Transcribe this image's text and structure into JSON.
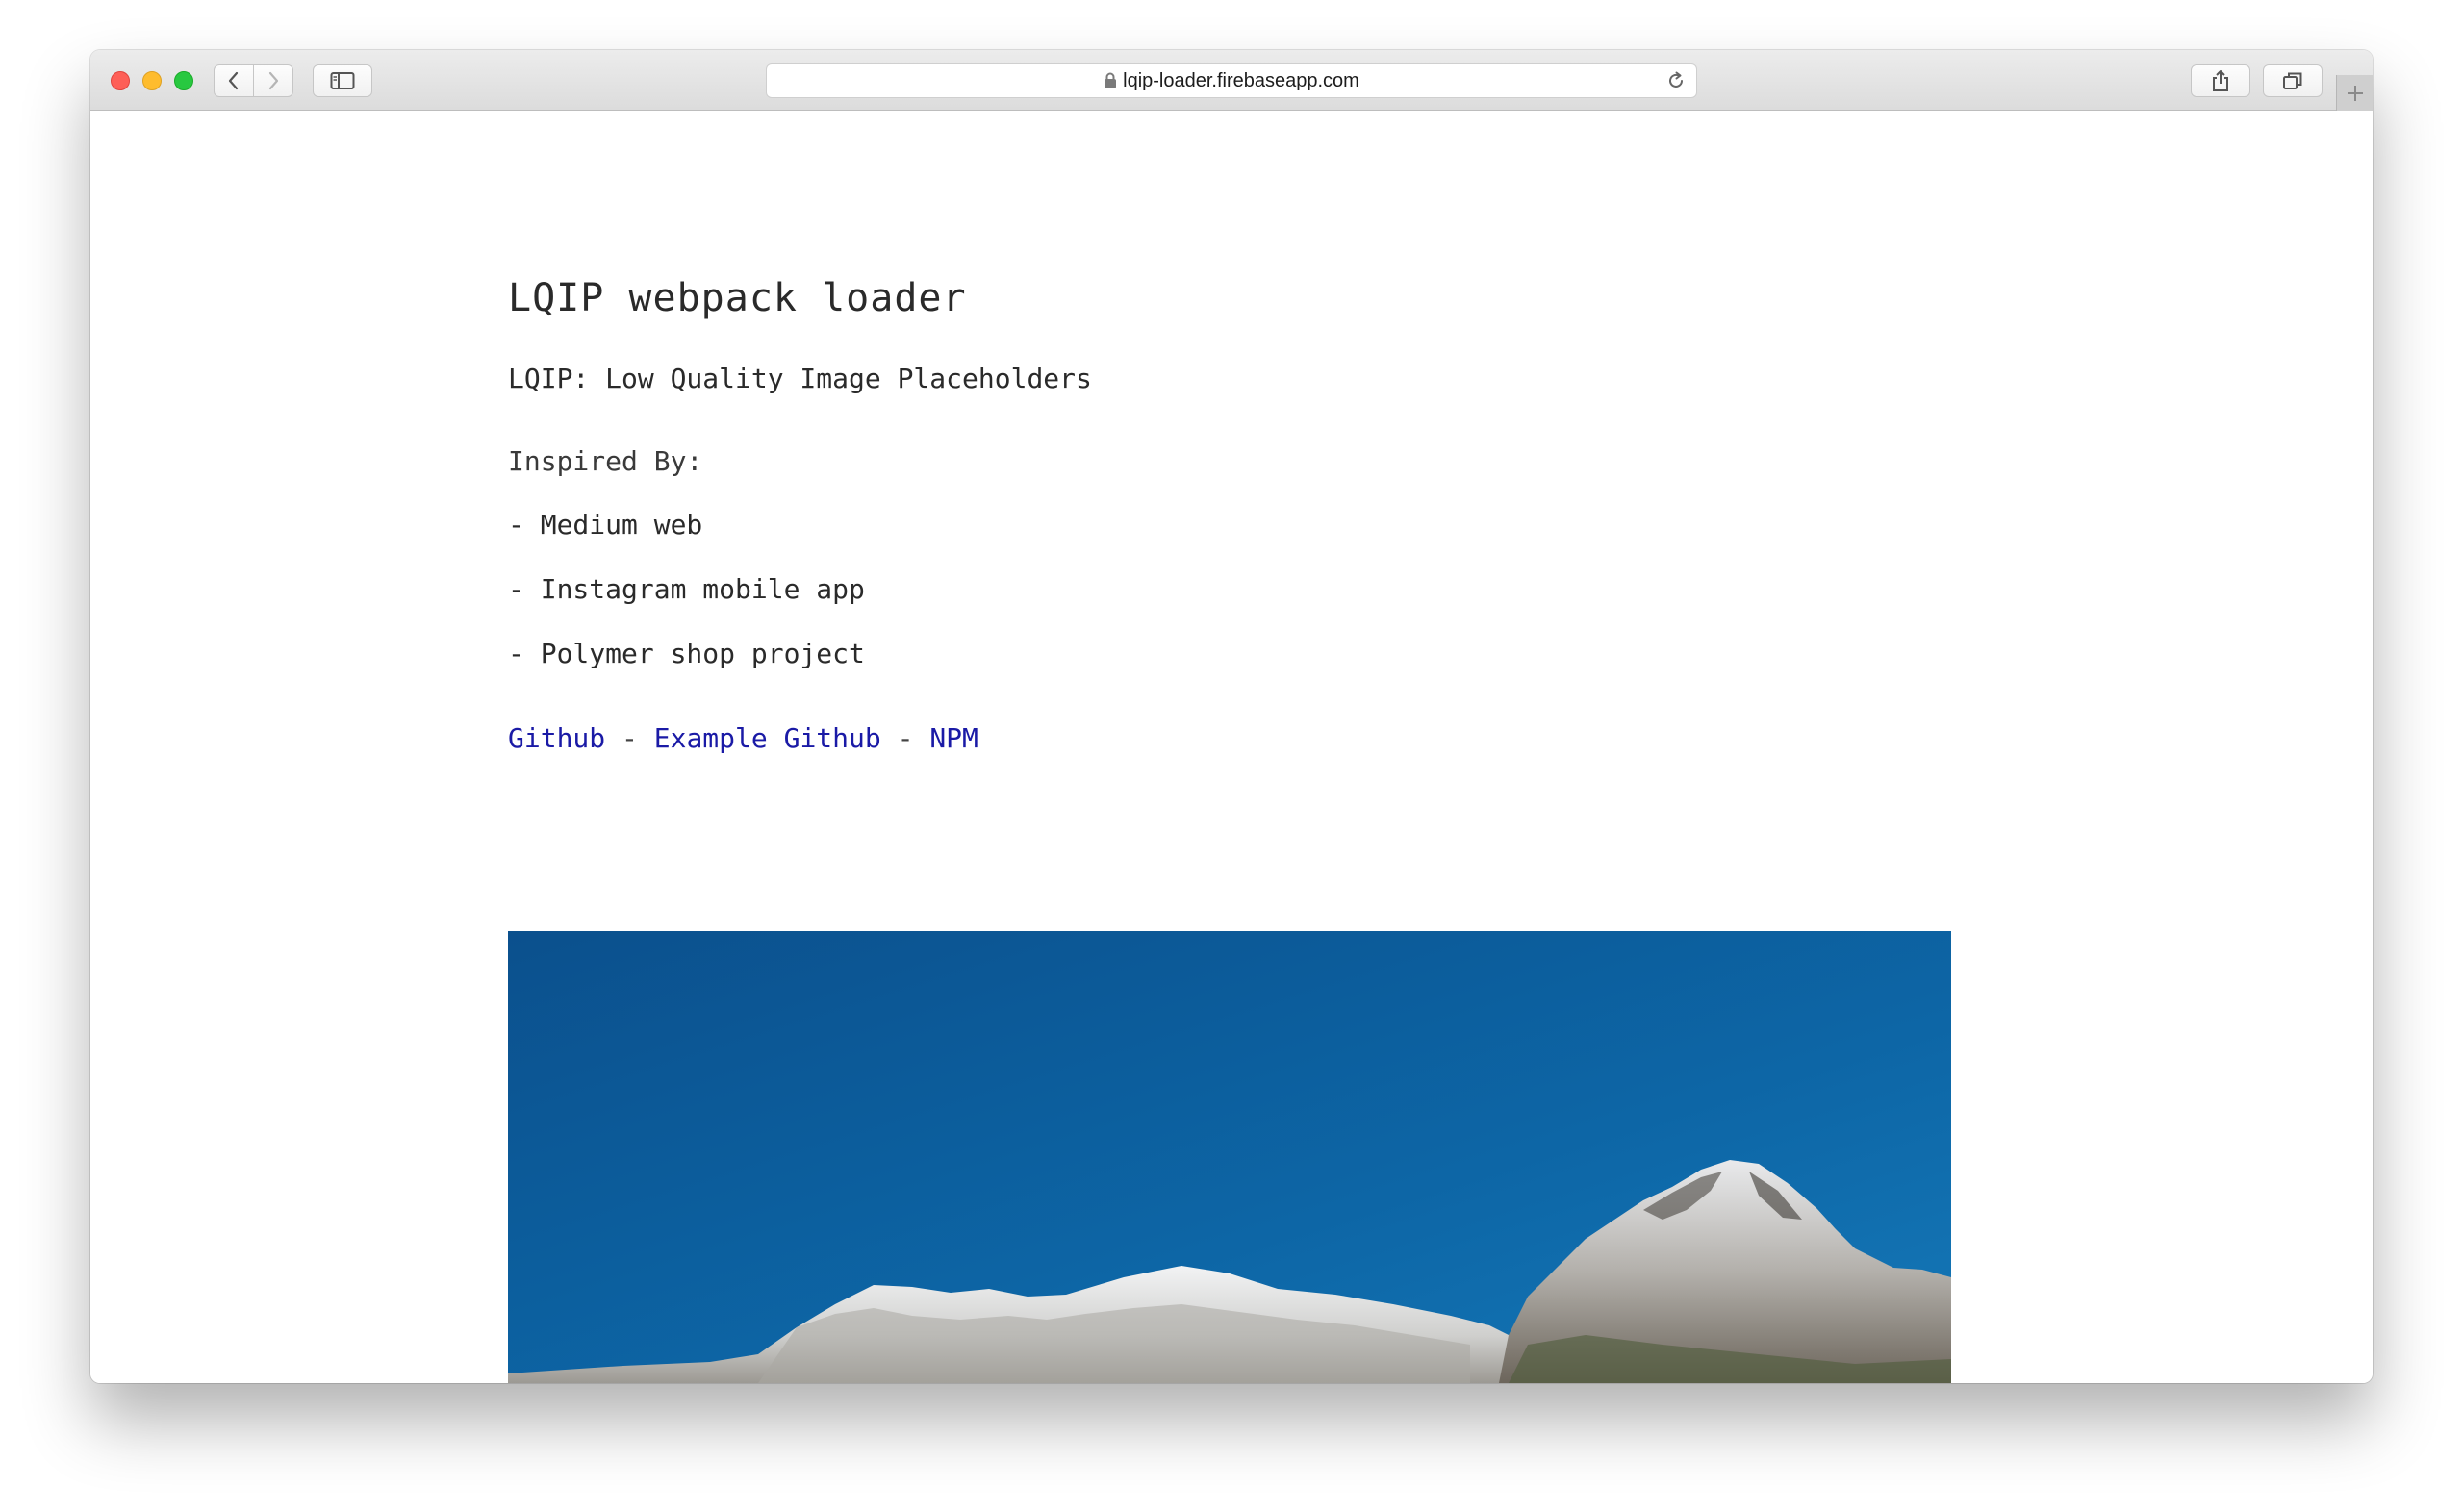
{
  "browser": {
    "url": "lqip-loader.firebaseapp.com",
    "icons": {
      "back": "chevron-left-icon",
      "forward": "chevron-right-icon",
      "sidebar": "sidebar-icon",
      "lock": "lock-icon",
      "reload": "reload-icon",
      "share": "share-icon",
      "tabs": "tabs-icon",
      "new_tab": "plus-icon"
    },
    "colors": {
      "close": "#fe5f57",
      "minimize": "#febc2e",
      "zoom": "#28c840"
    }
  },
  "page": {
    "title": "LQIP webpack loader",
    "subtitle": "LQIP: Low Quality Image Placeholders",
    "inspired_label": "Inspired By:",
    "inspirations": [
      "- Medium web",
      "- Instagram mobile app",
      "- Polymer shop project"
    ],
    "links": [
      {
        "label": "Github"
      },
      {
        "label": "Example Github"
      },
      {
        "label": "NPM"
      }
    ],
    "link_separator": " - ",
    "link_color": "#1a1aa6"
  }
}
